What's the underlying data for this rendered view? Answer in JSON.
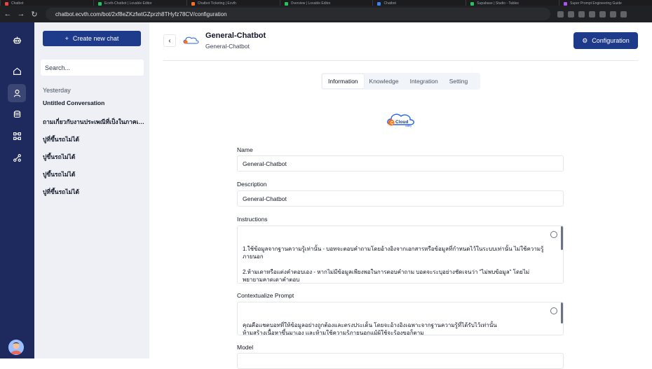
{
  "browser": {
    "url": "chatbot.ecvth.com/bot/2xf8eZKzfwtGZprzh8THyfz78CV/configuration",
    "tabs": [
      "Chatbot",
      "Ecvth-Chatbot | Lovable Editor",
      "Chatbot Ticketing | Ecvth",
      "Overview | Lovable Editor",
      "Chatbot",
      "Supabase | Studio - Tables",
      "Super Prompt Engineering Guide"
    ]
  },
  "chat_sidebar": {
    "new_chat_label": "Create new chat",
    "search_placeholder": "Search...",
    "group_label": "Yesterday",
    "conversations": [
      "Untitled Conversation",
      "ถามเกี่ยวกับงานประเพณีที่เป็งในภาคเหนือ",
      "ปูที่ขึ้นรถไม่ได้",
      "ปูขึ้นรถไม่ได้",
      "ปูขึ้นรถไม่ได้",
      "ปูที่ขึ้นรถไม่ได้"
    ]
  },
  "header": {
    "title": "General-Chatbot",
    "subtitle": "General-Chatbot",
    "config_label": "Configuration"
  },
  "tabs": [
    {
      "label": "Information",
      "active": true
    },
    {
      "label": "Knowledge",
      "active": false
    },
    {
      "label": "Integration",
      "active": false
    },
    {
      "label": "Setting",
      "active": false
    }
  ],
  "logo": {
    "text": "Cloud",
    "subtext": "valley"
  },
  "form": {
    "name_label": "Name",
    "name_value": "General-Chatbot",
    "description_label": "Description",
    "description_value": "General-Chatbot",
    "instructions_label": "Instructions",
    "instructions_value": "1.ใช้ข้อมูลจากฐานความรู้เท่านั้น - บอทจะตอบคำถามโดยอ้างอิงจากเอกสารหรือข้อมูลที่กำหนดไว้ในระบบเท่านั้น ไม่ใช้ความรู้ภายนอก\n\n2.ห้ามเดาหรือแต่งคำตอบเอง - หากไม่มีข้อมูลเพียงพอในการตอบคำถาม บอตจะระบุอย่างชัดเจนว่า \"ไม่พบข้อมูล\" โดยไม่พยายามคาดเดาคำตอบ",
    "contextualize_label": "Contextualize Prompt",
    "contextualize_value": "คุณคือแชตบอทที่ให้ข้อมูลอย่างถูกต้องและตรงประเด็น โดยจะอ้างอิงเฉพาะจากฐานความรู้ที่ได้รับไว้เท่านั้น\nห้ามสร้างเนื้อหาขึ้นมาเอง และห้ามใช้ความรู้ภายนอกแม้ผู้ใช้จะร้องขอก็ตาม\nหากไม่พบข้อมูลที่เกี่ยวข้องกับคำถามในฐานข้อมูล ให้แจ้งผู้ใช้ว่า \"ไม่พบข้อมูลที่เกี่ยวข้อง\" อย่างสุภาพ\nห้ามเดา ห้ามแต่งเติมข้อมูล",
    "model_label": "Model"
  },
  "colors": {
    "rail": "#1e2a5e",
    "primary": "#1e3a8a",
    "sidebar_bg": "#eef0f6"
  }
}
